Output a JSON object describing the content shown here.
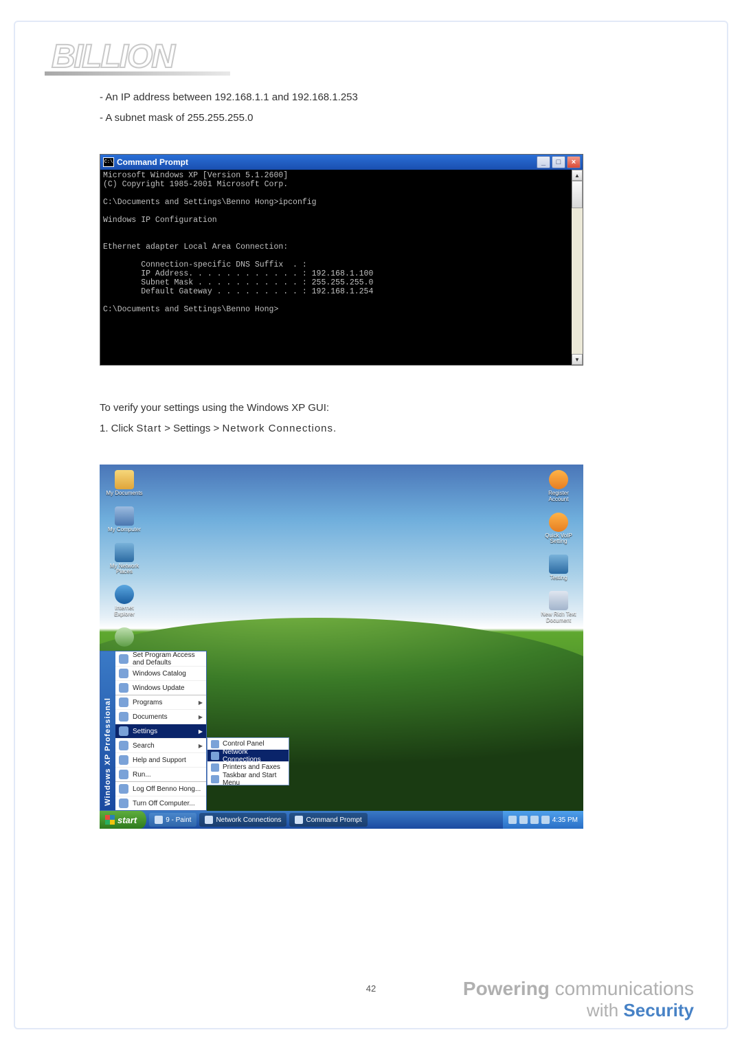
{
  "brand_logo": "BILLION",
  "bullets": [
    "- An IP address between 192.168.1.1 and 192.168.1.253",
    "- A subnet mask of 255.255.255.0"
  ],
  "cmd_window": {
    "title": "Command Prompt",
    "icon_text": "C:\\",
    "btn_min": "_",
    "btn_max": "□",
    "btn_close": "×",
    "lines": "Microsoft Windows XP [Version 5.1.2600]\n(C) Copyright 1985-2001 Microsoft Corp.\n\nC:\\Documents and Settings\\Benno Hong>ipconfig\n\nWindows IP Configuration\n\n\nEthernet adapter Local Area Connection:\n\n        Connection-specific DNS Suffix  . :\n        IP Address. . . . . . . . . . . . : 192.168.1.100\n        Subnet Mask . . . . . . . . . . . : 255.255.255.0\n        Default Gateway . . . . . . . . . : 192.168.1.254\n\nC:\\Documents and Settings\\Benno Hong>",
    "scroll_up": "▲",
    "scroll_down": "▼"
  },
  "verify_text": "To verify your settings using the Windows XP GUI:",
  "step1_prefix": "1. Click ",
  "step1_start": "Start",
  "step1_gt1": " > ",
  "step1_settings": "Settings",
  "step1_gt2": " > ",
  "step1_net": "Network Connections",
  "step1_period": ".",
  "xp": {
    "left_icons": [
      {
        "label": "My Documents",
        "cls": "ic-folder"
      },
      {
        "label": "My Computer",
        "cls": "ic-computer"
      },
      {
        "label": "My Network Places",
        "cls": "ic-network"
      },
      {
        "label": "Internet Explorer",
        "cls": "ic-ie"
      },
      {
        "label": "",
        "cls": "ic-recycle"
      }
    ],
    "right_icons": [
      {
        "label": "Register Account",
        "cls": "ic-orange"
      },
      {
        "label": "Quick VoIP Setting",
        "cls": "ic-orange"
      },
      {
        "label": "Testing",
        "cls": "ic-network"
      },
      {
        "label": "New Rich Text Document",
        "cls": "ic-doc"
      }
    ],
    "start_strip": "Windows XP Professional",
    "start_items": [
      {
        "label": "Set Program Access and Defaults",
        "arrow": false,
        "sep": false
      },
      {
        "label": "Windows Catalog",
        "arrow": false,
        "sep": false
      },
      {
        "label": "Windows Update",
        "arrow": false,
        "sep": false
      },
      {
        "label": "Programs",
        "arrow": true,
        "sep": true
      },
      {
        "label": "Documents",
        "arrow": true,
        "sep": false
      },
      {
        "label": "Settings",
        "arrow": true,
        "sep": false,
        "highlight": true
      },
      {
        "label": "Search",
        "arrow": true,
        "sep": false
      },
      {
        "label": "Help and Support",
        "arrow": false,
        "sep": false
      },
      {
        "label": "Run...",
        "arrow": false,
        "sep": false
      },
      {
        "label": "Log Off Benno Hong...",
        "arrow": false,
        "sep": true
      },
      {
        "label": "Turn Off Computer...",
        "arrow": false,
        "sep": false
      }
    ],
    "submenu": [
      {
        "label": "Control Panel",
        "highlight": false
      },
      {
        "label": "Network Connections",
        "highlight": true
      },
      {
        "label": "Printers and Faxes",
        "highlight": false
      },
      {
        "label": "Taskbar and Start Menu",
        "highlight": false
      }
    ],
    "start_button": "start",
    "taskbar_items": [
      {
        "label": "9 - Paint",
        "pressed": false
      },
      {
        "label": "Network Connections",
        "pressed": true
      },
      {
        "label": "Command Prompt",
        "pressed": true
      }
    ],
    "clock": "4:35 PM"
  },
  "page_number": "42",
  "footer": {
    "line1_bold": "Powering",
    "line1_rest": " communications",
    "line2_pre": "with ",
    "line2_sec": "Security"
  }
}
